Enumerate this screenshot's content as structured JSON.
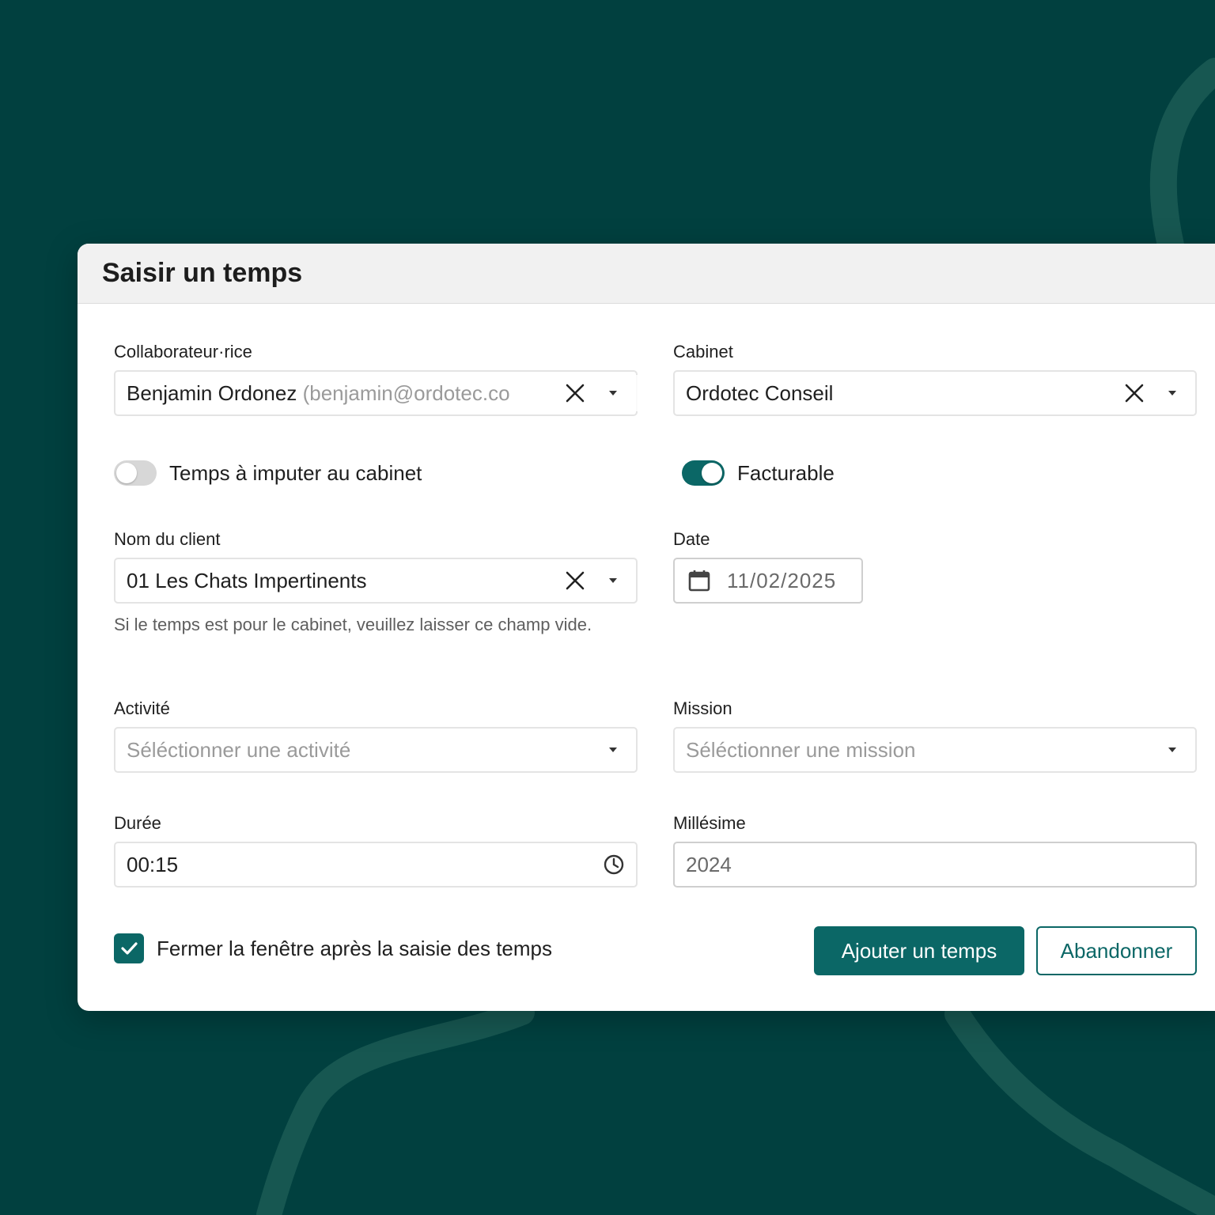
{
  "colors": {
    "background": "#01403f",
    "accent": "#0b6766",
    "surface": "#ffffff",
    "header": "#f1f1f1"
  },
  "dialog": {
    "title": "Saisir un temps"
  },
  "collaborator": {
    "label": "Collaborateur·rice",
    "name": "Benjamin Ordonez",
    "email": "(benjamin@ordotec.co"
  },
  "cabinet": {
    "label": "Cabinet",
    "value": "Ordotec Conseil"
  },
  "toggle_cabinet": {
    "label": "Temps à imputer au cabinet",
    "on": false
  },
  "toggle_billable": {
    "label": "Facturable",
    "on": true
  },
  "client": {
    "label": "Nom du client",
    "value": "01 Les Chats Impertinents",
    "helper": "Si le temps est pour le cabinet, veuillez laisser ce champ vide."
  },
  "date": {
    "label": "Date",
    "value": "11/02/2025"
  },
  "activity": {
    "label": "Activité",
    "placeholder": "Séléctionner une activité"
  },
  "mission": {
    "label": "Mission",
    "placeholder": "Séléctionner une mission"
  },
  "duration": {
    "label": "Durée",
    "value": "00:15"
  },
  "millesime": {
    "label": "Millésime",
    "value": "2024"
  },
  "close_after": {
    "label": "Fermer la fenêtre après la saisie des temps",
    "checked": true
  },
  "actions": {
    "submit_label": "Ajouter un temps",
    "cancel_label": "Abandonner"
  },
  "icons": [
    "close-icon",
    "chevron-down-icon",
    "calendar-icon",
    "clock-icon",
    "check-icon"
  ]
}
